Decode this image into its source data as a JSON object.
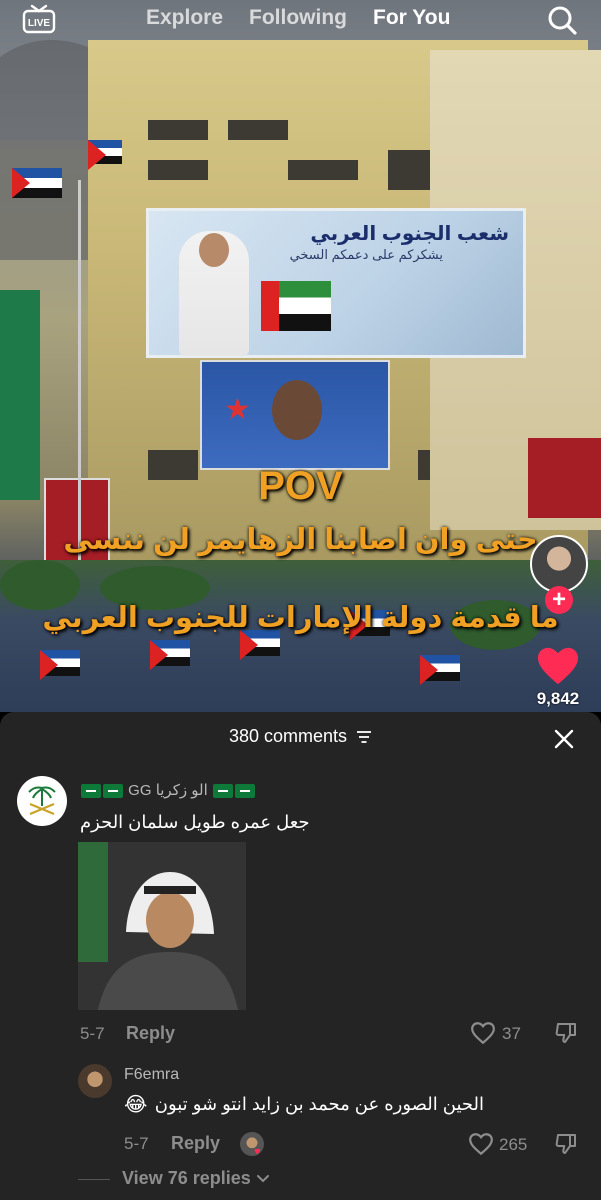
{
  "topbar": {
    "live_label": "LIVE",
    "tabs": [
      {
        "label": "Explore",
        "active": false
      },
      {
        "label": "Following",
        "active": false
      },
      {
        "label": "For You",
        "active": true
      }
    ]
  },
  "video": {
    "billboard_title": "شعب الجنوب العربي",
    "billboard_subtitle": "يشكركم على دعمكم السخي",
    "overlay_title": "POV",
    "caption_line1": "حتى وان اصابنا الزهايمر لن ننسى",
    "caption_line2": "ما قدمة دولة الإمارات للجنوب العربي",
    "like_count": "9,842"
  },
  "comments": {
    "header": "380 comments",
    "items": [
      {
        "username": "GG الو زكريا",
        "text": "جعل عمره طويل سلمان الحزم",
        "date": "5-7",
        "reply_label": "Reply",
        "likes": "37"
      },
      {
        "username": "F6emra",
        "emoji": "😂",
        "text": "الحين الصوره عن محمد بن زايد انتو شو تبون",
        "date": "5-7",
        "reply_label": "Reply",
        "likes": "265"
      }
    ],
    "view_replies": "View 76 replies"
  },
  "colors": {
    "accent": "#fe2c55",
    "caption": "#f0a023",
    "sheet_bg": "#242424",
    "muted_text": "#8d8d8d"
  },
  "icons": {
    "live": "live-tv-icon",
    "search": "search-icon",
    "sort": "sort-icon",
    "close": "close-icon",
    "like": "heart-icon",
    "dislike": "thumbs-down-icon",
    "follow": "plus-icon"
  }
}
